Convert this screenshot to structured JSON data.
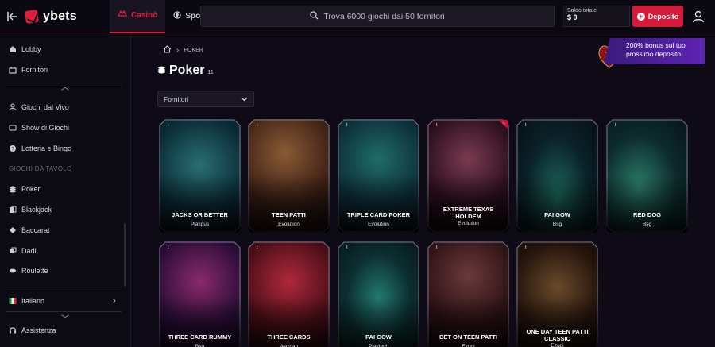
{
  "header": {
    "brand": "ybets",
    "tabs": [
      {
        "label": "Casinò",
        "icon": "casino-icon",
        "active": true
      },
      {
        "label": "Sport",
        "icon": "sport-icon",
        "active": false
      }
    ],
    "search_placeholder": "Trova 6000 giochi dai 50 fornitori",
    "balance_label": "Saldo totale",
    "balance_value": "$ 0",
    "deposit_label": "Deposito",
    "accent_color": "#d61a3a"
  },
  "sidebar": {
    "items": [
      {
        "label": "Lobby",
        "icon": "home-icon"
      },
      {
        "label": "Fornitori",
        "icon": "providers-icon"
      },
      {
        "label": "Giochi dal Vivo",
        "icon": "live-dealer-icon"
      },
      {
        "label": "Show di Giochi",
        "icon": "tv-icon"
      },
      {
        "label": "Lotteria e Bingo",
        "icon": "lottery-icon"
      },
      {
        "label": "Poker",
        "icon": "chips-icon"
      },
      {
        "label": "Blackjack",
        "icon": "cards-icon"
      },
      {
        "label": "Baccarat",
        "icon": "baccarat-icon"
      },
      {
        "label": "Dadi",
        "icon": "dice-icon"
      },
      {
        "label": "Roulette",
        "icon": "roulette-icon"
      }
    ],
    "section_label": "GIOCHI DA TAVOLO",
    "language": "Italiano",
    "support": "Assistenza"
  },
  "main": {
    "breadcrumb": "POKER",
    "title": "Poker",
    "count": "11",
    "filter_label": "Fornitori",
    "promo_text": "200% bonus sul tuo prossimo deposito"
  },
  "games": [
    {
      "name": "JACKS OR BETTER",
      "provider": "Platipus"
    },
    {
      "name": "TEEN PATTI",
      "provider": "Evolution"
    },
    {
      "name": "TRIPLE CARD POKER",
      "provider": "Evolution"
    },
    {
      "name": "EXTREME TEXAS HOLDEM",
      "provider": "Evolution"
    },
    {
      "name": "PAI GOW",
      "provider": "Bsg"
    },
    {
      "name": "RED DOG",
      "provider": "Bsg"
    },
    {
      "name": "THREE CARD RUMMY",
      "provider": "Bsg"
    },
    {
      "name": "THREE CARDS",
      "provider": "Wazdan"
    },
    {
      "name": "PAI GOW",
      "provider": "Playtech"
    },
    {
      "name": "BET ON TEEN PATTI",
      "provider": "Ezugi"
    },
    {
      "name": "ONE DAY TEEN PATTI CLASSIC",
      "provider": "Ezugi"
    }
  ]
}
